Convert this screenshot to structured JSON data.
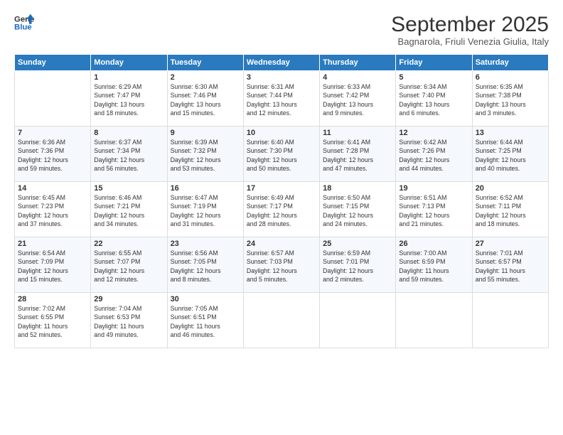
{
  "logo": {
    "line1": "General",
    "line2": "Blue"
  },
  "title": "September 2025",
  "location": "Bagnarola, Friuli Venezia Giulia, Italy",
  "days_of_week": [
    "Sunday",
    "Monday",
    "Tuesday",
    "Wednesday",
    "Thursday",
    "Friday",
    "Saturday"
  ],
  "weeks": [
    [
      {
        "day": "",
        "content": ""
      },
      {
        "day": "1",
        "content": "Sunrise: 6:29 AM\nSunset: 7:47 PM\nDaylight: 13 hours\nand 18 minutes."
      },
      {
        "day": "2",
        "content": "Sunrise: 6:30 AM\nSunset: 7:46 PM\nDaylight: 13 hours\nand 15 minutes."
      },
      {
        "day": "3",
        "content": "Sunrise: 6:31 AM\nSunset: 7:44 PM\nDaylight: 13 hours\nand 12 minutes."
      },
      {
        "day": "4",
        "content": "Sunrise: 6:33 AM\nSunset: 7:42 PM\nDaylight: 13 hours\nand 9 minutes."
      },
      {
        "day": "5",
        "content": "Sunrise: 6:34 AM\nSunset: 7:40 PM\nDaylight: 13 hours\nand 6 minutes."
      },
      {
        "day": "6",
        "content": "Sunrise: 6:35 AM\nSunset: 7:38 PM\nDaylight: 13 hours\nand 3 minutes."
      }
    ],
    [
      {
        "day": "7",
        "content": "Sunrise: 6:36 AM\nSunset: 7:36 PM\nDaylight: 12 hours\nand 59 minutes."
      },
      {
        "day": "8",
        "content": "Sunrise: 6:37 AM\nSunset: 7:34 PM\nDaylight: 12 hours\nand 56 minutes."
      },
      {
        "day": "9",
        "content": "Sunrise: 6:39 AM\nSunset: 7:32 PM\nDaylight: 12 hours\nand 53 minutes."
      },
      {
        "day": "10",
        "content": "Sunrise: 6:40 AM\nSunset: 7:30 PM\nDaylight: 12 hours\nand 50 minutes."
      },
      {
        "day": "11",
        "content": "Sunrise: 6:41 AM\nSunset: 7:28 PM\nDaylight: 12 hours\nand 47 minutes."
      },
      {
        "day": "12",
        "content": "Sunrise: 6:42 AM\nSunset: 7:26 PM\nDaylight: 12 hours\nand 44 minutes."
      },
      {
        "day": "13",
        "content": "Sunrise: 6:44 AM\nSunset: 7:25 PM\nDaylight: 12 hours\nand 40 minutes."
      }
    ],
    [
      {
        "day": "14",
        "content": "Sunrise: 6:45 AM\nSunset: 7:23 PM\nDaylight: 12 hours\nand 37 minutes."
      },
      {
        "day": "15",
        "content": "Sunrise: 6:46 AM\nSunset: 7:21 PM\nDaylight: 12 hours\nand 34 minutes."
      },
      {
        "day": "16",
        "content": "Sunrise: 6:47 AM\nSunset: 7:19 PM\nDaylight: 12 hours\nand 31 minutes."
      },
      {
        "day": "17",
        "content": "Sunrise: 6:49 AM\nSunset: 7:17 PM\nDaylight: 12 hours\nand 28 minutes."
      },
      {
        "day": "18",
        "content": "Sunrise: 6:50 AM\nSunset: 7:15 PM\nDaylight: 12 hours\nand 24 minutes."
      },
      {
        "day": "19",
        "content": "Sunrise: 6:51 AM\nSunset: 7:13 PM\nDaylight: 12 hours\nand 21 minutes."
      },
      {
        "day": "20",
        "content": "Sunrise: 6:52 AM\nSunset: 7:11 PM\nDaylight: 12 hours\nand 18 minutes."
      }
    ],
    [
      {
        "day": "21",
        "content": "Sunrise: 6:54 AM\nSunset: 7:09 PM\nDaylight: 12 hours\nand 15 minutes."
      },
      {
        "day": "22",
        "content": "Sunrise: 6:55 AM\nSunset: 7:07 PM\nDaylight: 12 hours\nand 12 minutes."
      },
      {
        "day": "23",
        "content": "Sunrise: 6:56 AM\nSunset: 7:05 PM\nDaylight: 12 hours\nand 8 minutes."
      },
      {
        "day": "24",
        "content": "Sunrise: 6:57 AM\nSunset: 7:03 PM\nDaylight: 12 hours\nand 5 minutes."
      },
      {
        "day": "25",
        "content": "Sunrise: 6:59 AM\nSunset: 7:01 PM\nDaylight: 12 hours\nand 2 minutes."
      },
      {
        "day": "26",
        "content": "Sunrise: 7:00 AM\nSunset: 6:59 PM\nDaylight: 11 hours\nand 59 minutes."
      },
      {
        "day": "27",
        "content": "Sunrise: 7:01 AM\nSunset: 6:57 PM\nDaylight: 11 hours\nand 55 minutes."
      }
    ],
    [
      {
        "day": "28",
        "content": "Sunrise: 7:02 AM\nSunset: 6:55 PM\nDaylight: 11 hours\nand 52 minutes."
      },
      {
        "day": "29",
        "content": "Sunrise: 7:04 AM\nSunset: 6:53 PM\nDaylight: 11 hours\nand 49 minutes."
      },
      {
        "day": "30",
        "content": "Sunrise: 7:05 AM\nSunset: 6:51 PM\nDaylight: 11 hours\nand 46 minutes."
      },
      {
        "day": "",
        "content": ""
      },
      {
        "day": "",
        "content": ""
      },
      {
        "day": "",
        "content": ""
      },
      {
        "day": "",
        "content": ""
      }
    ]
  ]
}
